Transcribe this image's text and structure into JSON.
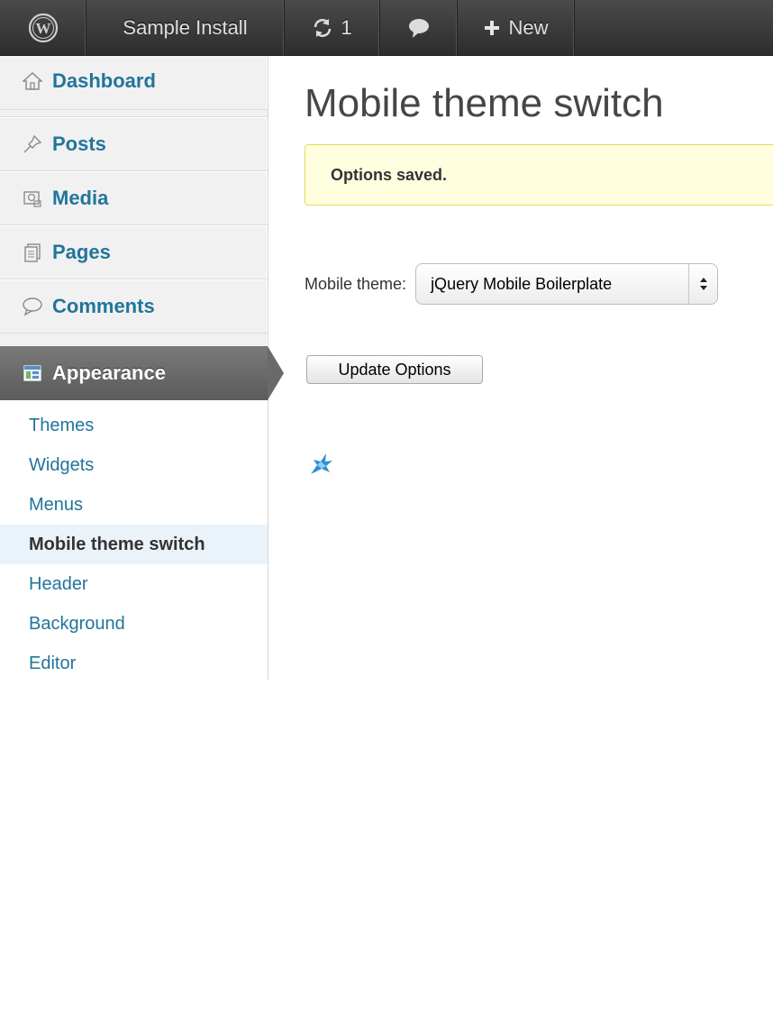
{
  "adminbar": {
    "wp_logo_icon": "wordpress-logo-icon",
    "site_name": "Sample Install",
    "updates_count": "1",
    "updates_icon": "refresh-icon",
    "comments_icon": "speech-bubble-icon",
    "new_label": "New",
    "new_icon": "plus-icon"
  },
  "sidebar": {
    "menu": [
      {
        "label": "Dashboard",
        "icon": "home-icon"
      },
      {
        "label": "Posts",
        "icon": "pushpin-icon"
      },
      {
        "label": "Media",
        "icon": "media-icon"
      },
      {
        "label": "Pages",
        "icon": "pages-icon"
      },
      {
        "label": "Comments",
        "icon": "comment-icon"
      },
      {
        "label": "Appearance",
        "icon": "appearance-icon"
      }
    ],
    "submenu": [
      {
        "label": "Themes"
      },
      {
        "label": "Widgets"
      },
      {
        "label": "Menus"
      },
      {
        "label": "Mobile theme switch"
      },
      {
        "label": "Header"
      },
      {
        "label": "Background"
      },
      {
        "label": "Editor"
      }
    ]
  },
  "main": {
    "title": "Mobile theme switch",
    "notice": "Options saved.",
    "form": {
      "label": "Mobile theme:",
      "selected": "jQuery Mobile Boilerplate"
    },
    "submit_label": "Update Options",
    "plugin_icon": "bird-logo-icon"
  },
  "colors": {
    "link": "#21759b",
    "adminbar": "#3a3a3a",
    "notice_bg": "#ffffe0",
    "notice_border": "#e6db55"
  }
}
